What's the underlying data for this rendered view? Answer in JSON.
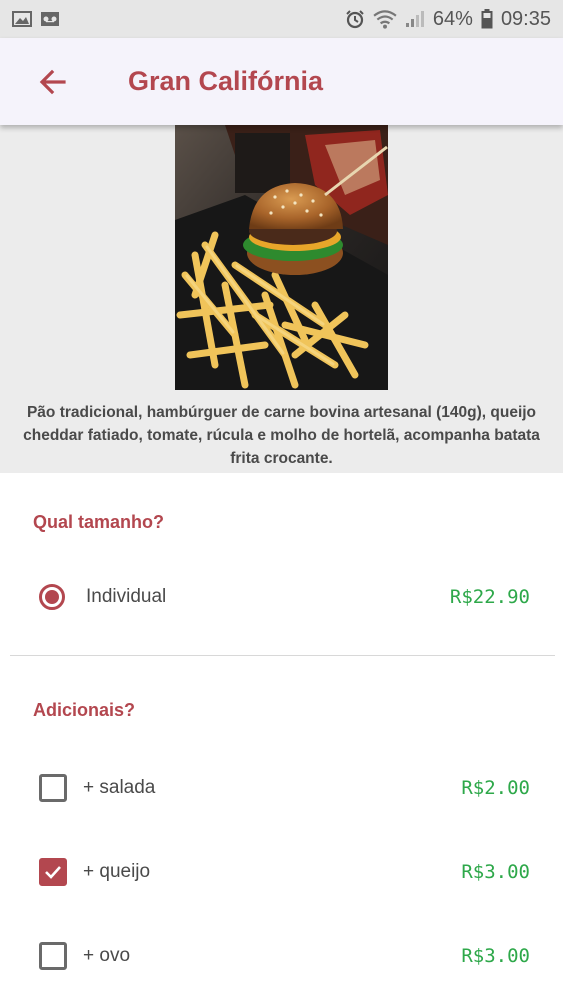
{
  "status_bar": {
    "battery": "64%",
    "time": "09:35",
    "left_icons": [
      "image-icon",
      "voicemail-icon"
    ],
    "right_icons": [
      "alarm-icon",
      "wifi-icon",
      "signal-icon",
      "battery-icon"
    ]
  },
  "app_bar": {
    "title": "Gran Califórnia",
    "back_icon": "arrow-left-icon"
  },
  "product": {
    "image": "burger-and-fries-photo",
    "description": "Pão tradicional, hambúrguer de carne bovina artesanal (140g), queijo cheddar fatiado, tomate, rúcula e molho de hortelã, acompanha batata frita crocante."
  },
  "size_section": {
    "title": "Qual tamanho?",
    "options": [
      {
        "label": "Individual",
        "price": "R$22.90",
        "selected": true
      }
    ]
  },
  "extras_section": {
    "title": "Adicionais?",
    "options": [
      {
        "label": "+ salada",
        "price": "R$2.00",
        "checked": false
      },
      {
        "label": "+ queijo",
        "price": "R$3.00",
        "checked": true
      },
      {
        "label": "+ ovo",
        "price": "R$3.00",
        "checked": false
      }
    ]
  },
  "colors": {
    "accent": "#b3474f",
    "price": "#2ea84a",
    "app_bar_bg": "#f5f3fb",
    "hero_bg": "#ececec"
  }
}
